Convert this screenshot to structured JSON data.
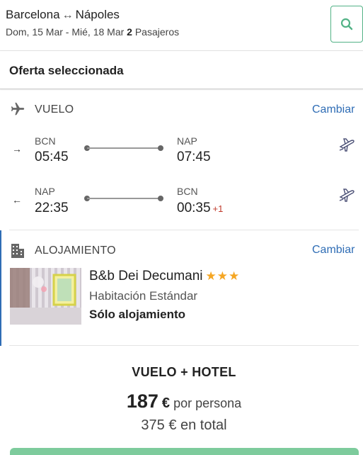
{
  "header": {
    "origin": "Barcelona",
    "swap_symbol": "↔",
    "destination": "Nápoles",
    "dates": "Dom, 15 Mar - Mié, 18 Mar",
    "passengers_count": "2",
    "passengers_label": "Pasajeros",
    "search_icon": "search-icon"
  },
  "offer": {
    "title": "Oferta seleccionada"
  },
  "flight": {
    "label": "VUELO",
    "change_label": "Cambiar",
    "outbound": {
      "direction_symbol": "→",
      "from_code": "BCN",
      "from_time": "05:45",
      "to_code": "NAP",
      "to_time": "07:45",
      "day_offset": ""
    },
    "return": {
      "direction_symbol": "←",
      "from_code": "NAP",
      "from_time": "22:35",
      "to_code": "BCN",
      "to_time": "00:35",
      "day_offset": "+1"
    }
  },
  "hotel": {
    "label": "ALOJAMIENTO",
    "change_label": "Cambiar",
    "name": "B&b Dei Decumani",
    "stars": "★★★",
    "star_count": 3,
    "room": "Habitación Estándar",
    "board": "Sólo alojamiento"
  },
  "price": {
    "package_label": "VUELO + HOTEL",
    "per_person_amount": "187",
    "currency": "€",
    "per_person_label": "por persona",
    "total_text": "375 € en total"
  },
  "colors": {
    "accent": "#2f6db5",
    "success": "#52b286",
    "stars": "#f5a623",
    "day_offset": "#c0392b"
  }
}
